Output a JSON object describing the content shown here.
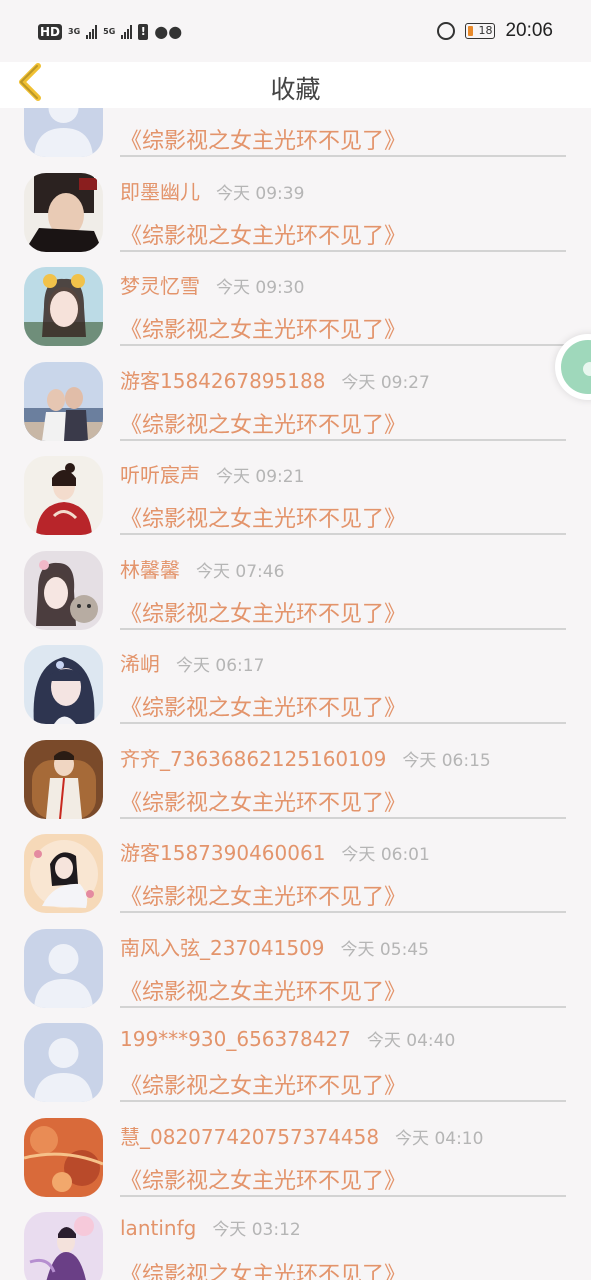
{
  "status_bar": {
    "hd_label": "HD",
    "hd_sub": "2",
    "net1": "3G",
    "net2": "5G",
    "battery": "18",
    "time": "20:06"
  },
  "header": {
    "title": "收藏"
  },
  "icons": {
    "back": "chevron-left-icon",
    "float": "floating-bubble-icon"
  },
  "colors": {
    "accent": "#e3946b",
    "back_arrow": "#f0c032",
    "time_text": "#b5b5b5",
    "divider": "#d3d3d3",
    "background": "#f7f5f6"
  },
  "items": [
    {
      "name": "",
      "time": "",
      "title": "《综影视之女主光环不见了》",
      "avatar": "default"
    },
    {
      "name": "即墨幽儿",
      "time": "今天 09:39",
      "title": "《综影视之女主光环不见了》",
      "avatar": "dark-man"
    },
    {
      "name": "梦灵忆雪",
      "time": "今天 09:30",
      "title": "《综影视之女主光环不见了》",
      "avatar": "girl-ears"
    },
    {
      "name": "游客1584267895188",
      "time": "今天 09:27",
      "title": "《综影视之女主光环不见了》",
      "avatar": "couple-beach"
    },
    {
      "name": "听听宸声",
      "time": "今天 09:21",
      "title": "《综影视之女主光环不见了》",
      "avatar": "red-robe"
    },
    {
      "name": "林馨馨",
      "time": "今天 07:46",
      "title": "《综影视之女主光环不见了》",
      "avatar": "girl-cat"
    },
    {
      "name": "浠岄",
      "time": "今天 06:17",
      "title": "《综影视之女主光环不见了》",
      "avatar": "anime-girl"
    },
    {
      "name": "齐齐_73636862125160109",
      "time": "今天 06:15",
      "title": "《综影视之女主光环不见了》",
      "avatar": "man-chair"
    },
    {
      "name": "游客1587390460061",
      "time": "今天 06:01",
      "title": "《综影视之女主光环不见了》",
      "avatar": "anime-white"
    },
    {
      "name": "南风入弦_237041509",
      "time": "今天 05:45",
      "title": "《综影视之女主光环不见了》",
      "avatar": "default"
    },
    {
      "name": "199***930_656378427",
      "time": "今天 04:40",
      "title": "《综影视之女主光环不见了》",
      "avatar": "default"
    },
    {
      "name": "慧_082077420757374458",
      "time": "今天 04:10",
      "title": "《综影视之女主光环不见了》",
      "avatar": "orange-art"
    },
    {
      "name": "lantinfg",
      "time": "今天 03:12",
      "title": "《综影视之女主光环不见了》",
      "avatar": "purple-fairy"
    }
  ]
}
